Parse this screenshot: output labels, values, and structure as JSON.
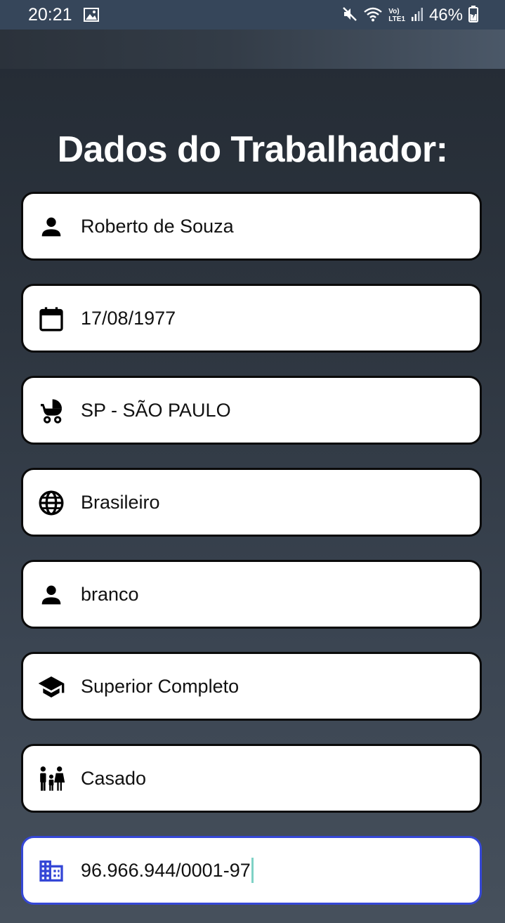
{
  "status_bar": {
    "time": "20:21",
    "battery": "46%",
    "network_top": "Vo)",
    "network_bottom": "LTE1"
  },
  "form": {
    "title": "Dados do Trabalhador:",
    "fields": [
      {
        "id": "nome",
        "icon": "person-icon",
        "value": "Roberto de Souza"
      },
      {
        "id": "data-nascimento",
        "icon": "calendar-icon",
        "value": "17/08/1977"
      },
      {
        "id": "naturalidade",
        "icon": "stroller-icon",
        "value": "SP - SÃO PAULO"
      },
      {
        "id": "nacionalidade",
        "icon": "globe-icon",
        "value": "Brasileiro"
      },
      {
        "id": "raca-cor",
        "icon": "person-icon",
        "value": "branco"
      },
      {
        "id": "escolaridade",
        "icon": "graduation-cap-icon",
        "value": "Superior Completo"
      },
      {
        "id": "estado-civil",
        "icon": "family-icon",
        "value": "Casado"
      },
      {
        "id": "cnpj",
        "icon": "building-icon",
        "value": "96.966.944/0001-97",
        "focused": true
      }
    ]
  },
  "colors": {
    "focus_border": "#3547d6",
    "caret": "#7fd2c6",
    "field_border": "#0a0a0a"
  }
}
